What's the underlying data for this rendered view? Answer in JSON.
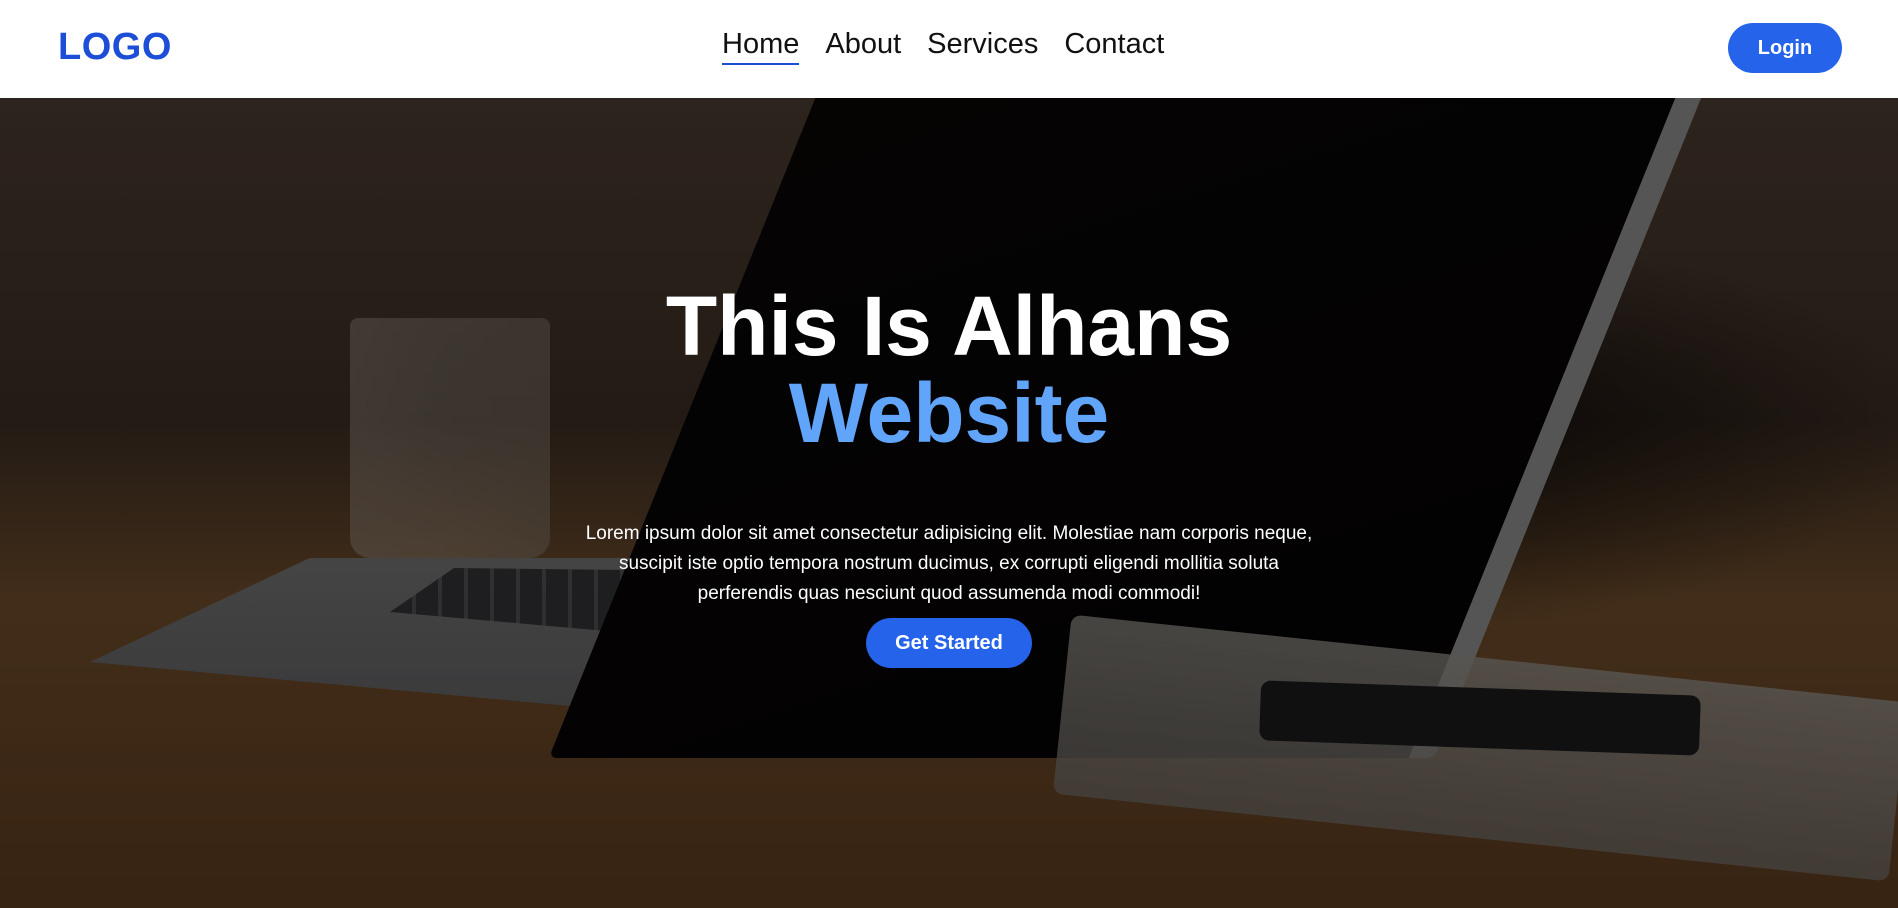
{
  "nav": {
    "logo": "LOGO",
    "links": [
      {
        "label": "Home",
        "active": true
      },
      {
        "label": "About",
        "active": false
      },
      {
        "label": "Services",
        "active": false
      },
      {
        "label": "Contact",
        "active": false
      }
    ],
    "login_label": "Login"
  },
  "hero": {
    "title_line1": "This Is Alhans",
    "title_line2": "Website",
    "description": "Lorem ipsum dolor sit amet consectetur adipisicing elit. Molestiae nam corporis neque, suscipit iste optio tempora nostrum ducimus, ex corrupti eligendi mollitia soluta perferendis quas nesciunt quod assumenda modi commodi!",
    "cta_label": "Get Started"
  },
  "colors": {
    "accent": "#2563eb",
    "logo": "#1d4ed8",
    "highlight": "#60a5fa",
    "navbar_bg": "#ffffff"
  }
}
